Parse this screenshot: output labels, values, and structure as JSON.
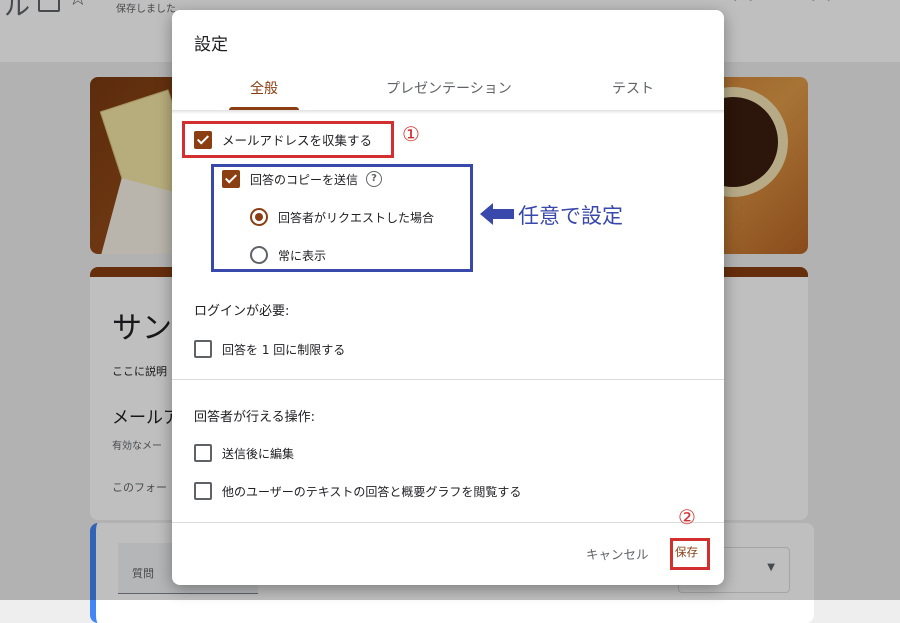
{
  "background": {
    "doc_title": "ル",
    "saved_status": "保存しました",
    "form_title": "サン",
    "form_description": "ここに説明",
    "email_title": "メールア",
    "email_note": "有効なメー",
    "form_footer": "このフォー",
    "question_label": "質問"
  },
  "dialog": {
    "title": "設定",
    "tabs": [
      {
        "label": "全般",
        "active": true
      },
      {
        "label": "プレゼンテーション",
        "active": false
      },
      {
        "label": "テスト",
        "active": false
      }
    ],
    "collect_email": {
      "label": "メールアドレスを収集する",
      "checked": true
    },
    "send_copy": {
      "label": "回答のコピーを送信",
      "checked": true,
      "help_icon": "?"
    },
    "copy_options": [
      {
        "label": "回答者がリクエストした場合",
        "selected": true
      },
      {
        "label": "常に表示",
        "selected": false
      }
    ],
    "login_section": "ログインが必要:",
    "limit_one": {
      "label": "回答を 1 回に制限する",
      "checked": false
    },
    "respondent_section": "回答者が行える操作:",
    "edit_after": {
      "label": "送信後に編集",
      "checked": false
    },
    "view_summary": {
      "label": "他のユーザーのテキストの回答と概要グラフを閲覧する",
      "checked": false
    },
    "cancel_label": "キャンセル",
    "save_label": "保存"
  },
  "annotations": {
    "marker_1": "①",
    "marker_2": "②",
    "arrow_note": "任意で設定"
  },
  "colors": {
    "accent": "#8a3e12",
    "annotation_red": "#d32f2f",
    "annotation_blue": "#3949ab"
  }
}
